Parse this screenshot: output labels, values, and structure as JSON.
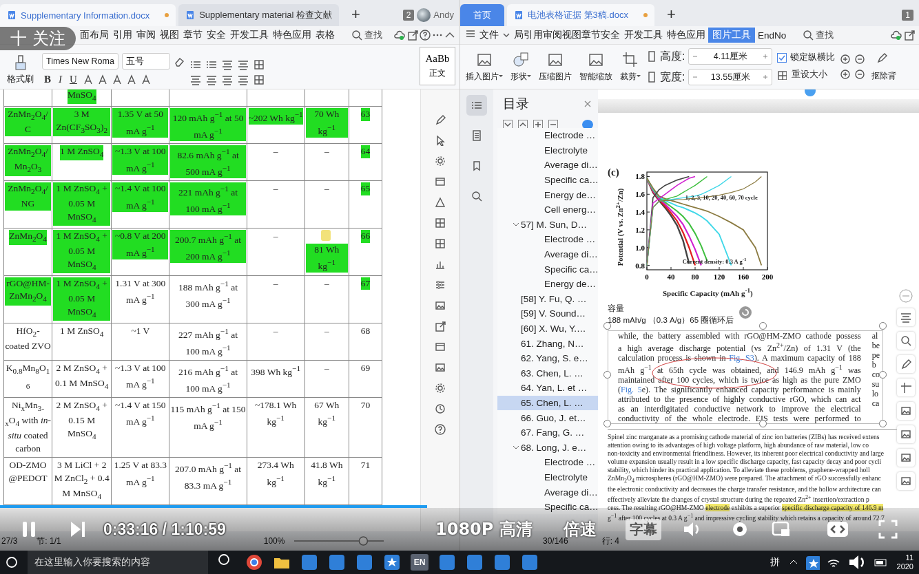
{
  "left_window": {
    "tabs": [
      {
        "title": "Supplementary Information.docx",
        "selected": true,
        "unsaved": true
      },
      {
        "title": "Supplementary material 检查文献",
        "selected": false,
        "unsaved": false
      }
    ],
    "new_tab": "+",
    "window_count": "2",
    "user": "Andy",
    "menu": [
      {
        "label": "面布局",
        "selected": false
      },
      {
        "label": "引用",
        "selected": false
      },
      {
        "label": "审阅",
        "selected": false
      },
      {
        "label": "视图",
        "selected": false
      },
      {
        "label": "章节",
        "selected": false
      },
      {
        "label": "安全",
        "selected": false
      },
      {
        "label": "开发工具",
        "selected": false
      },
      {
        "label": "特色应用",
        "selected": false
      },
      {
        "label": "表格",
        "selected": false
      }
    ],
    "search": "查找",
    "format_painter": "格式刷",
    "font": "Times New Roma",
    "font_size": "五号",
    "format_buttons": [
      "B",
      "I",
      "U"
    ],
    "style_preview": "AaBb",
    "style_name": "正文",
    "table": {
      "rows": [
        {
          "cells": [
            {},
            {
              "text": "MnSO$_{4}$",
              "highlighted": true
            },
            {},
            {},
            {},
            {},
            {}
          ]
        },
        {
          "cells": [
            {
              "text": "ZnMn$_{2}$O$_{4}$/C",
              "highlighted": true
            },
            {
              "text": "3 M Zn(CF$_{3}$SO$_{3}$)$_{2}$",
              "highlighted": true
            },
            {
              "text": "1.35 V at 50 mA g$^{−1}$",
              "highlighted": true
            },
            {
              "text": "120 mAh g$^{−1}$ at 50 mA g$^{−1}$",
              "highlighted": true
            },
            {
              "text": "~202 Wh kg$^{−1}$",
              "highlighted": true
            },
            {
              "text": "70 Wh kg$^{−1}$",
              "highlighted": true
            },
            {
              "text": "63",
              "highlighted": true
            }
          ]
        },
        {
          "cells": [
            {
              "text": "ZnMn$_{2}$O$_{4}$/Mn$_{2}$O$_{3}$",
              "highlighted": true
            },
            {
              "text": "1 M ZnSO$_{4}$",
              "highlighted": true
            },
            {
              "text": "~1.3 V at 100 mA g$^{−1}$",
              "highlighted": true
            },
            {
              "text": "82.6 mAh g$^{−1}$ at 500 mA g$^{−1}$",
              "highlighted": true
            },
            {
              "text": "–",
              "highlighted": false
            },
            {
              "text": "–",
              "highlighted": false
            },
            {
              "text": "64",
              "highlighted": true
            }
          ]
        },
        {
          "cells": [
            {
              "text": "ZnMn$_{2}$O$_{4}$/NG",
              "highlighted": true
            },
            {
              "text": "1 M ZnSO$_{4}$ + 0.05 M MnSO$_{4}$",
              "highlighted": true
            },
            {
              "text": "~1.4 V at 100 mA g$^{−1}$",
              "highlighted": true
            },
            {
              "text": "221 mAh g$^{−1}$ at 100 mA g$^{−1}$",
              "highlighted": true
            },
            {
              "text": "–",
              "highlighted": false
            },
            {
              "text": "–",
              "highlighted": false
            },
            {
              "text": "65",
              "highlighted": true
            }
          ]
        },
        {
          "cells": [
            {
              "text": "ZnMn$_{2}$O$_{4}$",
              "highlighted": true
            },
            {
              "text": "1 M ZnSO$_{4}$ + 0.05 M MnSO$_{4}$",
              "highlighted": true
            },
            {
              "text": "~0.8 V at 200 mA g$^{−1}$",
              "highlighted": true
            },
            {
              "text": "200.7 mAh g$^{−1}$ at 200 mA g$^{−1}$",
              "highlighted": true
            },
            {
              "text": "–",
              "highlighted": false
            },
            {
              "text": "81 Wh kg$^{−1}$",
              "highlighted": true,
              "comment": true
            },
            {
              "text": "66",
              "highlighted": true
            }
          ]
        },
        {
          "cells": [
            {
              "text": "rGO@HM-ZnMn$_{2}$O$_{4}$",
              "highlighted": true
            },
            {
              "text": "1 M ZnSO$_{4}$ + 0.05 M MnSO$_{4}$",
              "highlighted": true
            },
            {
              "text": "1.31 V at 300 mA g$^{−1}$",
              "highlighted": false
            },
            {
              "text": "188 mAh g$^{−1}$ at 300 mA g$^{−1}$",
              "highlighted": false
            },
            {
              "text": "–",
              "highlighted": false
            },
            {
              "text": "–",
              "highlighted": false
            },
            {
              "text": "67",
              "highlighted": true
            }
          ]
        },
        {
          "cells": [
            {
              "text": "HfO$_{2}$-coated ZVO",
              "highlighted": false
            },
            {
              "text": "1 M ZnSO$_{4}$",
              "highlighted": false
            },
            {
              "text": "~1 V",
              "highlighted": false
            },
            {
              "text": "227 mAh g$^{−1}$ at 100 mA g$^{−1}$",
              "highlighted": false
            },
            {
              "text": "–",
              "highlighted": false
            },
            {
              "text": "–",
              "highlighted": false
            },
            {
              "text": "68",
              "highlighted": false
            }
          ]
        },
        {
          "cells": [
            {
              "text": "K$_{0.8}$Mn$_{8}$O$_{16}$",
              "highlighted": false
            },
            {
              "text": "2 M ZnSO$_{4}$ + 0.1 M MnSO$_{4}$",
              "highlighted": false
            },
            {
              "text": "~1.3 V at 100 mA g$^{−1}$",
              "highlighted": false
            },
            {
              "text": "216 mAh g$^{−1}$ at 100 mA g$^{−1}$",
              "highlighted": false
            },
            {
              "text": "398 Wh kg$^{−1}$",
              "highlighted": false
            },
            {
              "text": "–",
              "highlighted": false
            },
            {
              "text": "69",
              "highlighted": false
            }
          ]
        },
        {
          "cells": [
            {
              "text": "Ni$_{x}$Mn$_{3-x}$O$_{4}$ with *in-situ* coated carbon",
              "highlighted": false
            },
            {
              "text": "2 M ZnSO$_{4}$ + 0.15 M MnSO$_{4}$",
              "highlighted": false
            },
            {
              "text": "~1.4 V at 150 mA g$^{−1}$",
              "highlighted": false
            },
            {
              "text": "115 mAh g$^{−1}$ at 150 mA g$^{−1}$",
              "highlighted": false
            },
            {
              "text": "~178.1 Wh kg$^{−1}$",
              "highlighted": false
            },
            {
              "text": "67 Wh kg$^{−1}$",
              "highlighted": false
            },
            {
              "text": "70",
              "highlighted": false
            }
          ]
        },
        {
          "cells": [
            {
              "text": "OD-ZMO @PEDOT",
              "highlighted": false
            },
            {
              "text": "3 M LiCl + 2 M ZnCl$_{2}$ + 0.4 M MnSO$_{4}$",
              "highlighted": false
            },
            {
              "text": "1.25 V at 83.3 mA g$^{−1}$",
              "highlighted": false
            },
            {
              "text": "207.0 mAh g$^{−1}$ at 83.3 mA g$^{−1}$",
              "highlighted": false
            },
            {
              "text": "273.4 Wh kg$^{−1}$",
              "highlighted": false
            },
            {
              "text": "41.8 Wh kg$^{−1}$",
              "highlighted": false
            },
            {
              "text": "71",
              "highlighted": false
            }
          ]
        }
      ]
    },
    "status": [
      "27/3",
      "节: 1/1",
      "100%"
    ],
    "zoom_slider": {
      "level": 0.8
    }
  },
  "right_window": {
    "tabs": [
      {
        "title": "首页",
        "kind": "home",
        "selected": false,
        "unsaved": false
      },
      {
        "title": "电池表格证据 第3稿.docx",
        "kind": "doc",
        "selected": true,
        "unsaved": true
      }
    ],
    "new_tab": "+",
    "window_count": "1",
    "file_menu": "文件",
    "menu": [
      {
        "label": "局引用审阅视图章节安全",
        "selected": false
      },
      {
        "label": "开发工具",
        "selected": false
      },
      {
        "label": "特色应用",
        "selected": false
      },
      {
        "label": "图片工具",
        "selected": true
      },
      {
        "label": "EndNo",
        "selected": false
      }
    ],
    "search": "查找",
    "tools": [
      {
        "label": "插入图片",
        "dropdown": true
      },
      {
        "label": "形状",
        "dropdown": true
      },
      {
        "label": "压缩图片",
        "dropdown": false
      },
      {
        "label": "智能缩放",
        "dropdown": false
      },
      {
        "label": "裁剪",
        "dropdown": true
      }
    ],
    "height": {
      "label": "高度:",
      "value": "4.11厘米"
    },
    "width": {
      "label": "宽度:",
      "value": "13.55厘米"
    },
    "lock_ratio": {
      "label": "锁定纵横比",
      "checked": true
    },
    "reset_size": "重设大小",
    "remove_background": "抠除背",
    "toc": {
      "title": "目录",
      "items": [
        {
          "children": [
            {
              "label": "Electrode …",
              "selected": false
            },
            {
              "label": "Electrolyte",
              "selected": false
            },
            {
              "label": "Average di…",
              "selected": false
            },
            {
              "label": "Specific ca…",
              "selected": false
            },
            {
              "label": "Energy de…",
              "selected": false
            },
            {
              "label": "Cell energ…",
              "selected": false
            }
          ]
        },
        {
          "label": "57] M. Sun, D…",
          "selected": false,
          "expanded": true,
          "children": [
            {
              "label": "Electrode …",
              "selected": false
            },
            {
              "label": "Average di…",
              "selected": false
            },
            {
              "label": "Specific ca…",
              "selected": false
            },
            {
              "label": "Energy de…",
              "selected": false
            }
          ]
        },
        {
          "label": "[58] Y. Fu, Q. …",
          "selected": false
        },
        {
          "label": "[59] V. Sound…",
          "selected": false
        },
        {
          "label": "[60] X. Wu, Y.…",
          "selected": false
        },
        {
          "label": "61. Zhang, N…",
          "selected": false
        },
        {
          "label": "62. Yang, S. e…",
          "selected": false
        },
        {
          "label": "63. Chen, L. …",
          "selected": false
        },
        {
          "label": "64. Yan, L. et …",
          "selected": false
        },
        {
          "label": "65. Chen, L. …",
          "selected": true
        },
        {
          "label": "66. Guo, J. et…",
          "selected": false
        },
        {
          "label": "67. Fang, G. …",
          "selected": false
        },
        {
          "label": "68. Long, J. e…",
          "selected": false,
          "expanded": true,
          "children": [
            {
              "label": "Electrode …",
              "selected": false
            },
            {
              "label": "Electrolyte",
              "selected": false
            },
            {
              "label": "Average di…",
              "selected": false
            },
            {
              "label": "Specific ca…",
              "selected": false
            }
          ]
        }
      ]
    },
    "document": {
      "chart_data": {
        "type": "line",
        "title": "(c)",
        "xlabel": "Specific Capacity (mAh g$^{-1}$)",
        "ylabel": "Potential (V vs. Zn$^{2+}$/Zn)",
        "x": [
          0,
          10,
          20,
          30,
          40,
          50,
          60,
          70,
          80,
          90,
          100,
          120,
          140,
          160,
          180,
          190
        ],
        "xlim": [
          0,
          200
        ],
        "ylim": [
          0.75,
          1.85
        ],
        "xticks": [
          0,
          40,
          80,
          120,
          160,
          200
        ],
        "yticks": [
          0.8,
          {
            "value": 1.0,
            "label": "1.0"
          },
          1.2,
          1.4,
          1.6,
          1.8
        ],
        "series": [
          {
            "color": "#444444",
            "values": [
              1.78,
              1.62,
              1.53,
              1.45,
              1.36,
              1.25,
              1.08,
              0.82,
              null,
              null,
              null,
              null,
              null,
              null,
              null,
              null
            ]
          },
          {
            "color": "#e02020",
            "values": [
              1.78,
              1.63,
              1.54,
              1.47,
              1.39,
              1.3,
              1.17,
              1.0,
              0.8,
              null,
              null,
              null,
              null,
              null,
              null,
              null
            ]
          },
          {
            "color": "#d020d0",
            "values": [
              1.78,
              1.64,
              1.55,
              1.49,
              1.42,
              1.35,
              1.26,
              1.13,
              0.98,
              0.8,
              null,
              null,
              null,
              null,
              null,
              null
            ]
          },
          {
            "color": "#40c040",
            "values": [
              1.78,
              1.65,
              1.56,
              1.51,
              1.46,
              1.41,
              1.35,
              1.27,
              1.16,
              1.02,
              0.85,
              null,
              null,
              null,
              null,
              null
            ]
          },
          {
            "color": "#40d8e8",
            "values": [
              1.78,
              1.66,
              1.57,
              1.53,
              1.5,
              1.47,
              1.45,
              1.42,
              1.39,
              1.35,
              1.3,
              1.15,
              0.8,
              null,
              null,
              null
            ]
          },
          {
            "color": "#8a7a40",
            "values": [
              1.78,
              1.67,
              1.58,
              1.55,
              1.53,
              1.51,
              1.49,
              1.47,
              1.45,
              1.43,
              1.41,
              1.35,
              1.28,
              1.2,
              1.0,
              0.8
            ]
          },
          {
            "color": "#444444",
            "values": [
              0.8,
              1.56,
              1.65,
              1.7,
              1.73,
              1.76,
              1.78,
              1.8,
              null,
              null,
              null,
              null,
              null,
              null,
              null,
              null
            ]
          },
          {
            "color": "#d020d0",
            "values": [
              0.8,
              1.5,
              1.55,
              1.6,
              1.65,
              1.7,
              1.74,
              1.78,
              1.8,
              null,
              null,
              null,
              null,
              null,
              null,
              null
            ]
          },
          {
            "color": "#40c040",
            "values": [
              0.8,
              1.45,
              1.52,
              1.54,
              1.56,
              1.58,
              1.62,
              1.66,
              1.7,
              1.75,
              1.8,
              null,
              null,
              null,
              null,
              null
            ]
          },
          {
            "color": "#40d8e8",
            "values": [
              0.8,
              1.45,
              1.52,
              1.53,
              1.54,
              1.55,
              1.56,
              1.57,
              1.58,
              1.6,
              1.63,
              1.7,
              1.8,
              null,
              null,
              null
            ]
          },
          {
            "color": "#8a7a40",
            "values": [
              0.8,
              1.45,
              1.52,
              1.53,
              1.53,
              1.54,
              1.54,
              1.55,
              1.55,
              1.56,
              1.57,
              1.59,
              1.62,
              1.66,
              1.74,
              1.8
            ]
          }
        ],
        "annotations": [
          "1, 2, 3, 10, 20, 40, 60, 70 cycle",
          "Current density: 0.3 A g$^{-1}$"
        ]
      },
      "caption": [
        "容量",
        "188 mAh/g （0.3 A/g）65 圈循环后"
      ],
      "excerpt_lines": [
        [
          "while, the battery assembled with rGO@HM-ZMO cathode possess"
        ],
        [
          "a high average discharge potential (vs Zn$^{2+}$/Zn) of 1.31 V (the"
        ],
        [
          "calculation process is shown in ",
          {
            "text": "Fig. S3",
            "kind": "link"
          },
          "). A maximum capacity of 188"
        ],
        [
          "mAh g$^{−1}$ at 65th cycle was obtained, and 146.9 mAh g$^{−1}$ was"
        ],
        [
          "maintained after 100 cycles, which is twice as high as the pure ZMO"
        ],
        [
          "(",
          {
            "text": "Fig. 5",
            "kind": "link"
          },
          "e). The significantly enhanced capacity performance is mainly"
        ],
        [
          "attributed to the presence of highly conductive rGO, which can act"
        ],
        [
          "as an interdigitated conductive network to improve the electrical"
        ],
        [
          "conductivity of the whole electrode. EIS tests were performed to"
        ]
      ],
      "excerpt_side": [
        "al",
        "be",
        "pe",
        "b",
        "co",
        "su",
        "lo",
        "ca"
      ],
      "abstract_lines": [
        [
          "Spinel zinc manganate as a promising cathode material of zinc ion batteries (ZIBs) has received extens"
        ],
        [
          "attention owing to its advantages of high voltage platform, high abundance of raw material, low co"
        ],
        [
          "non-toxicity and environmental friendliness. However, its inherent poor electrical conductivity and large"
        ],
        [
          "volume expansion usually result in a low specific discharge capacity, fast capacity decay and poor cycli"
        ],
        [
          "stability, which hinder its practical application. To alleviate these problems, graphene-wrapped holl"
        ],
        [
          "ZnMn$_{2}$O$_{4}$ microspheres (rGO@HM-ZMO) were prepared. The attachment of rGO successfully enhanc"
        ],
        [
          "the electronic conductivity and decreases the charge transfer resistance, and the hollow architecture can"
        ],
        [
          "effectively alleviate the changes of crystal structure during the repeated Zn$^{2+}$ insertion/extraction p"
        ],
        [
          "cess. The resulting rGO@HM-ZMO ",
          {
            "text": "electrode",
            "kind": "highlight"
          },
          " exhibits a superior ",
          {
            "text": "specific discharge capacity of 146.9 m",
            "kind": "highlight"
          }
        ],
        [
          "g$^{−1}$ after 100 cycles at 0.3 A g$^{−1}$ and impressive cycling stability which retains a capacity of around 72.7"
        ]
      ]
    },
    "status": [
      "30/146",
      "行: 4"
    ]
  },
  "video_player": {
    "time": "0:33:16 / 1:10:59",
    "quality": "1080P 高清",
    "speed": "倍速",
    "subtitles": {
      "label": "字幕",
      "on": false
    },
    "level": 0.465
  },
  "follow_button": "十 关注",
  "taskbar": {
    "search_placeholder": "在这里输入你要搜索的内容",
    "language": "EN",
    "ime": "拼",
    "clock": [
      "11",
      "2020"
    ]
  }
}
